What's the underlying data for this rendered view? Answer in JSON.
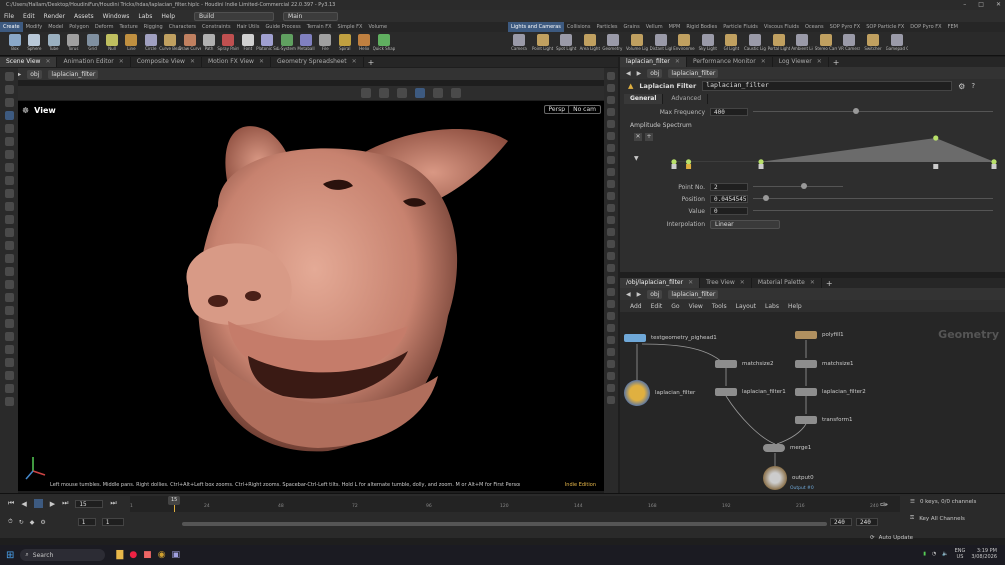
{
  "window": {
    "title": "C:/Users/Hallam/Desktop/HoudiniFun/Houdini Tricks/hdas/laplacian_filter.hiplc - Houdini Indie Limited-Commercial 22.0.397 - Py3.13",
    "controls": [
      "–",
      "□",
      "✕"
    ]
  },
  "menu": {
    "items": [
      "File",
      "Edit",
      "Render",
      "Assets",
      "Windows",
      "Labs",
      "Help"
    ],
    "desktop": "Build",
    "main": "Main"
  },
  "shelf": {
    "tabs_left": [
      "Create",
      "Modify",
      "Model",
      "Polygon",
      "Deform",
      "Texture",
      "Rigging",
      "Characters",
      "Constraints",
      "Hair Utils",
      "Guide Process",
      "Terrain FX",
      "Simple FX",
      "Volume"
    ],
    "tabs_right": [
      "Lights and Cameras",
      "Collisions",
      "Particles",
      "Grains",
      "Vellum",
      "MPM",
      "Rigid Bodies",
      "Particle Fluids",
      "Viscous Fluids",
      "Oceans",
      "SOP Pyro FX",
      "SOP Particle FX",
      "DOP Pyro FX",
      "FEM"
    ],
    "tools_left": [
      "Box",
      "Sphere",
      "Tube",
      "Torus",
      "Grid",
      "Null",
      "Line",
      "Circle",
      "Curve Bezier",
      "Draw Curve",
      "Path",
      "Spray Paint",
      "Font",
      "Platonic Solids",
      "L-System",
      "Metaball",
      "File",
      "Spiral",
      "Helix",
      "Quick Shapes"
    ],
    "tools_right": [
      "Camera",
      "Point Light",
      "Spot Light",
      "Area Light",
      "Geometry Light",
      "Volume Light",
      "Distant Light",
      "Environment Light",
      "Sky Light",
      "GI Light",
      "Caustic Light",
      "Portal Light",
      "Ambient Light",
      "Stereo Camera",
      "VR Camera",
      "Switcher",
      "Gamepad Camera"
    ]
  },
  "left_panel": {
    "tabs": [
      "Scene View",
      "Animation Editor",
      "Composite View",
      "Motion FX View",
      "Geometry Spreadsheet"
    ],
    "path": [
      "obj",
      "laplacian_filter"
    ]
  },
  "viewport": {
    "label": "View",
    "persp": "Persp",
    "cam": "No cam",
    "hint": "Left mouse tumbles. Middle pans. Right dollies. Ctrl+Alt+Left box zooms. Ctrl+Right zooms. Spacebar-Ctrl-Left tilts. Hold L for alternate tumble, dolly, and zoom. M or Alt+M for First Person Navigation.",
    "edition": "Indie Edition"
  },
  "params": {
    "tabs": [
      "laplacian_filter",
      "Performance Monitor",
      "Log Viewer"
    ],
    "path": [
      "obj",
      "laplacian_filter"
    ],
    "node_type": "Laplacian Filter",
    "node_name": "laplacian_filter",
    "subtabs": [
      "General",
      "Advanced"
    ],
    "max_frequency_label": "Max Frequency",
    "max_frequency": "400",
    "ramp_label": "Amplitude Spectrum",
    "point_no_label": "Point No.",
    "point_no": "2",
    "position_label": "Position",
    "position": "0.0454545",
    "value_label": "Value",
    "value": "0",
    "interp_label": "Interpolation",
    "interp": "Linear",
    "ramp_points": [
      0.0,
      0.0455,
      0.272,
      0.818,
      1.0
    ],
    "ramp_values": [
      0.0,
      0.0,
      0.0,
      1.0,
      0.0
    ]
  },
  "network": {
    "tabs": [
      "/obj/laplacian_filter",
      "Tree View",
      "Material Palette"
    ],
    "path": [
      "obj",
      "laplacian_filter"
    ],
    "menu": [
      "Add",
      "Edit",
      "Go",
      "View",
      "Tools",
      "Layout",
      "Labs",
      "Help"
    ],
    "context": "Geometry",
    "nodes": {
      "n1": "testgeometry_pighead1",
      "n2": "matchsize2",
      "n3": "laplacian_filter",
      "n4": "laplacian_filter1",
      "n5": "polyfill1",
      "n6": "matchsize1",
      "n7": "laplacian_filter2",
      "n8": "transform1",
      "n9": "merge1",
      "n10": "output0",
      "n10sub": "Output #0"
    }
  },
  "timeline": {
    "frame": "15",
    "start": "1",
    "start2": "1",
    "end": "240",
    "end2": "240",
    "ticks": [
      "1",
      "24",
      "48",
      "72",
      "96",
      "120",
      "144",
      "168",
      "192",
      "216",
      "240"
    ],
    "keys": "0 keys, 0/0 channels",
    "key_all": "Key All Channels",
    "auto_update": "Auto Update"
  },
  "taskbar": {
    "search": "Search",
    "lang1": "ENG",
    "lang2": "US",
    "time": "3:19 PM",
    "date": "3/08/2026"
  },
  "colors": {
    "accent": "#3d5a80",
    "ramp_point": "#b8e06a",
    "selected_node": "#e0b040",
    "node": "#8d8d8d"
  }
}
